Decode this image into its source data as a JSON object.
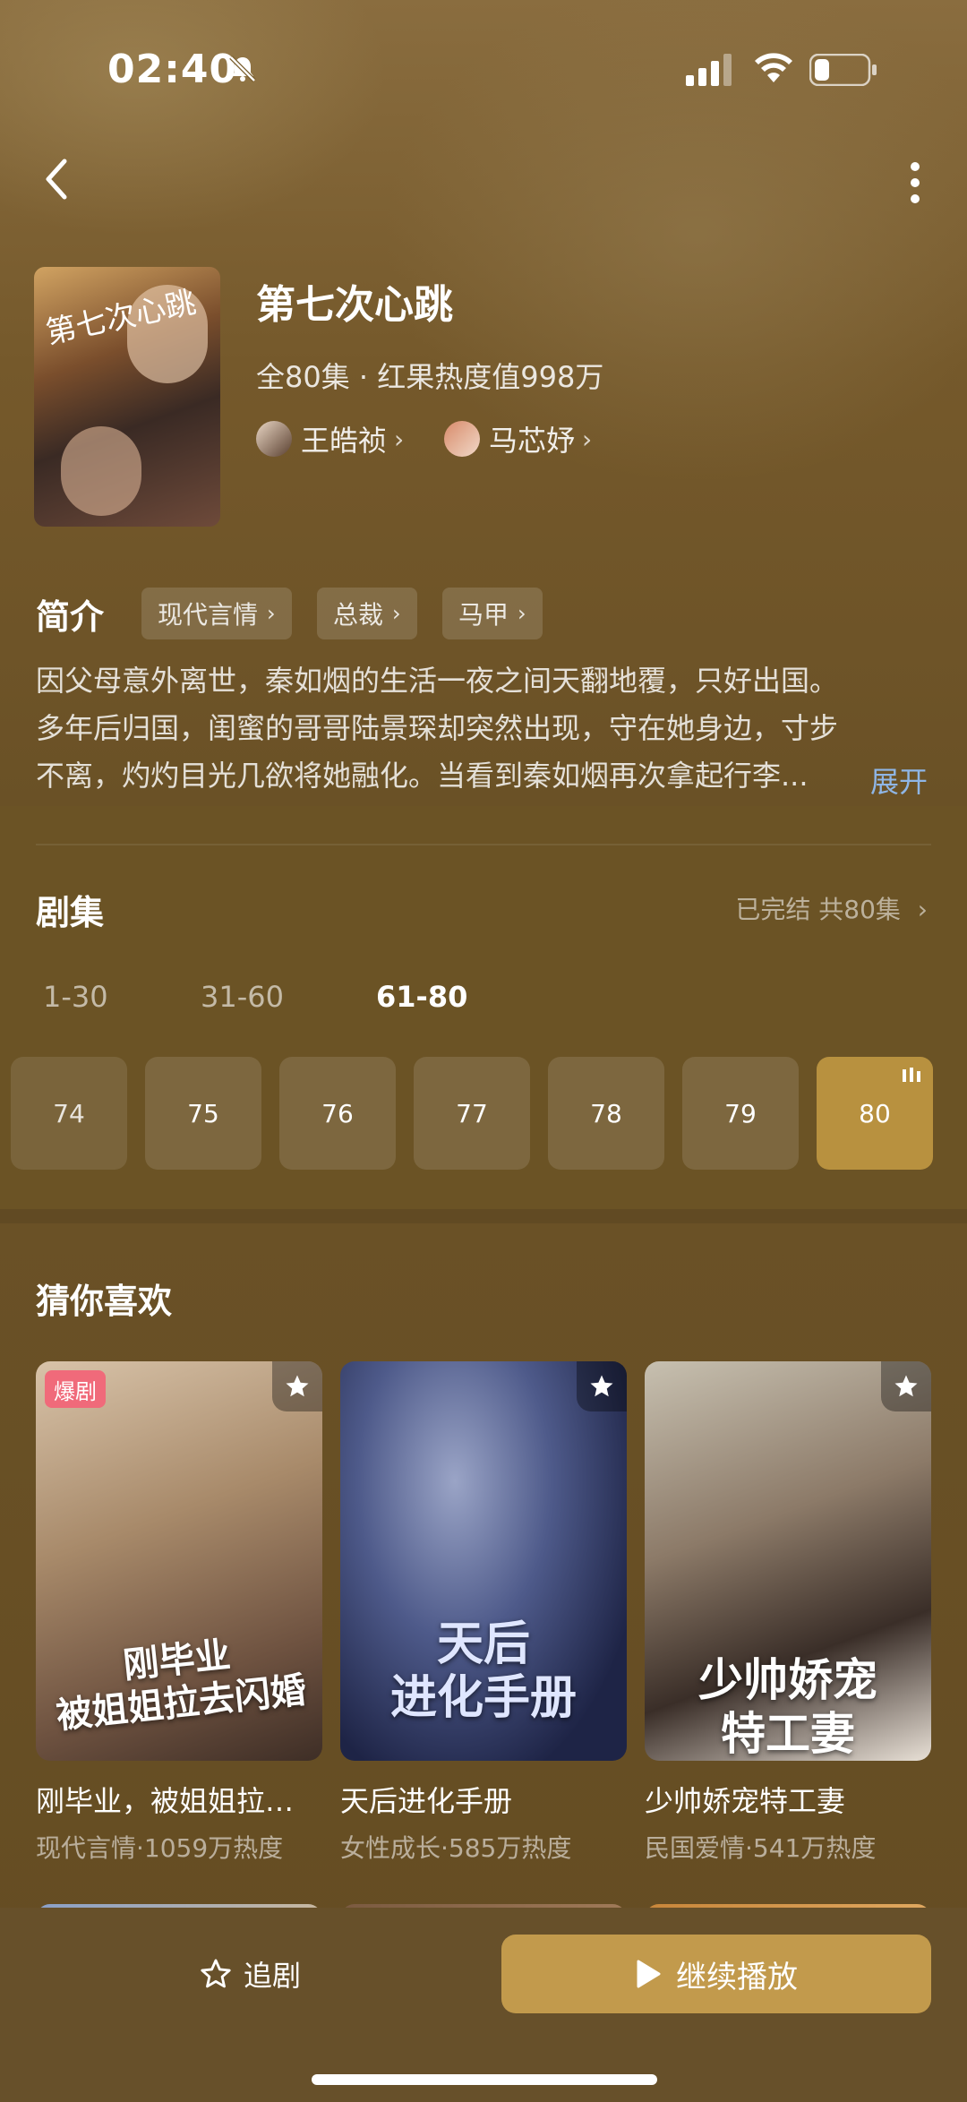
{
  "status_bar": {
    "time": "02:40"
  },
  "drama": {
    "title": "第七次心跳",
    "poster_text": "第七次心跳",
    "meta": "全80集 · 红果热度值998万",
    "actors": [
      {
        "name": "王皓祯"
      },
      {
        "name": "马芯妤"
      }
    ]
  },
  "intro": {
    "label": "简介",
    "tags": [
      "现代言情",
      "总裁",
      "马甲"
    ],
    "description": "因父母意外离世，秦如烟的生活一夜之间天翻地覆，只好出国。多年后归国，闺蜜的哥哥陆景琛却突然出现，守在她身边，寸步不离，灼灼目光几欲将她融化。当看到秦如烟再次拿起行李...",
    "expand": "展开"
  },
  "episodes": {
    "label": "剧集",
    "status": "已完结 共80集",
    "ranges": [
      "1-30",
      "31-60",
      "61-80"
    ],
    "active_range": "61-80",
    "items": [
      "74",
      "75",
      "76",
      "77",
      "78",
      "79",
      "80"
    ],
    "current": "80"
  },
  "recommend": {
    "label": "猜你喜欢",
    "cards": [
      {
        "title": "刚毕业，被姐姐拉…",
        "sub": "现代言情·1059万热度",
        "badge": "爆剧",
        "overlay": "刚毕业\n被姐姐拉去闪婚"
      },
      {
        "title": "天后进化手册",
        "sub": "女性成长·585万热度",
        "overlay": "天后\n进化手册"
      },
      {
        "title": "少帅娇宠特工妻",
        "sub": "民国爱情·541万热度",
        "overlay": "少帅娇宠\n特工妻"
      }
    ]
  },
  "bottom": {
    "follow": "追剧",
    "play": "继续播放"
  },
  "colors": {
    "accent": "#c29a4c",
    "background": "#6b5325",
    "link": "#8fb6e6",
    "badge": "#f06a7a"
  }
}
